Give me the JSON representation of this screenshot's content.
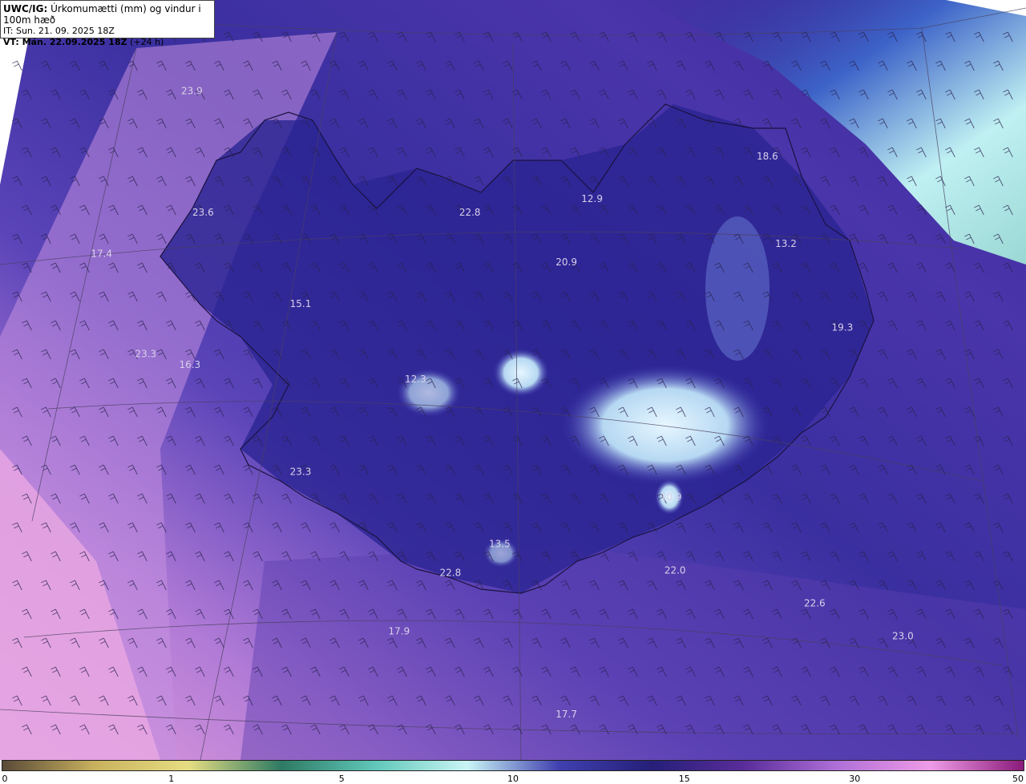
{
  "header": {
    "model_label": "UWC/IG:",
    "title_rest": " Úrkomumætti (mm) og vindur i 100m hæð",
    "issue_line": "IT: Sun. 21. 09. 2025 18Z",
    "valid_prefix": "VT:",
    "valid_bold": " Mán. 22.09.2025 18Z",
    "valid_suffix": " (+24 h)"
  },
  "values": [
    {
      "t": "23.9",
      "x": 0.187,
      "y": 0.124
    },
    {
      "t": "23.6",
      "x": 0.198,
      "y": 0.284
    },
    {
      "t": "17.4",
      "x": 0.099,
      "y": 0.338
    },
    {
      "t": "22.8",
      "x": 0.458,
      "y": 0.284
    },
    {
      "t": "12.9",
      "x": 0.577,
      "y": 0.266
    },
    {
      "t": "18.6",
      "x": 0.748,
      "y": 0.21
    },
    {
      "t": "13.2",
      "x": 0.766,
      "y": 0.325
    },
    {
      "t": "20.9",
      "x": 0.552,
      "y": 0.349
    },
    {
      "t": "15.1",
      "x": 0.293,
      "y": 0.404
    },
    {
      "t": "19.3",
      "x": 0.821,
      "y": 0.435
    },
    {
      "t": "23.3",
      "x": 0.142,
      "y": 0.47
    },
    {
      "t": "16.3",
      "x": 0.185,
      "y": 0.484
    },
    {
      "t": "12.3",
      "x": 0.405,
      "y": 0.503
    },
    {
      "t": "23.3",
      "x": 0.293,
      "y": 0.625
    },
    {
      "t": "10.9",
      "x": 0.654,
      "y": 0.658
    },
    {
      "t": "13.5",
      "x": 0.487,
      "y": 0.72
    },
    {
      "t": "22.8",
      "x": 0.439,
      "y": 0.758
    },
    {
      "t": "22.0",
      "x": 0.658,
      "y": 0.755
    },
    {
      "t": "22.6",
      "x": 0.794,
      "y": 0.798
    },
    {
      "t": "23.0",
      "x": 0.88,
      "y": 0.841
    },
    {
      "t": "17.9",
      "x": 0.389,
      "y": 0.835
    },
    {
      "t": "17.7",
      "x": 0.552,
      "y": 0.944
    }
  ],
  "colorbar": {
    "ticks": [
      "0",
      "1",
      "5",
      "10",
      "15",
      "30",
      "50"
    ],
    "stops": [
      "#5a4a38",
      "#c9b25e",
      "#e6dd82",
      "#2e7a63",
      "#5fc7b9",
      "#c9f5f5",
      "#4040b0",
      "#251f78",
      "#5a2d9a",
      "#b070d8",
      "#ee9be6",
      "#8a1a7a"
    ]
  },
  "legend_tick_positions": [
    0.002,
    0.167,
    0.333,
    0.5,
    0.667,
    0.833,
    0.998
  ]
}
